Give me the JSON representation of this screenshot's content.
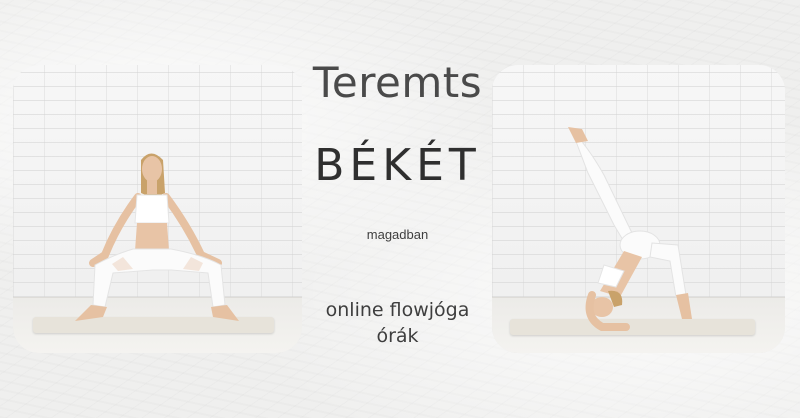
{
  "headline": {
    "line1": "Teremts",
    "line2": "BÉKÉT",
    "line3": "magadban",
    "line4": "online flowjóga",
    "line5": "órák"
  },
  "colors": {
    "text": "#4a4a4a",
    "accent": "#2f2f2f",
    "background": "#efefee"
  }
}
